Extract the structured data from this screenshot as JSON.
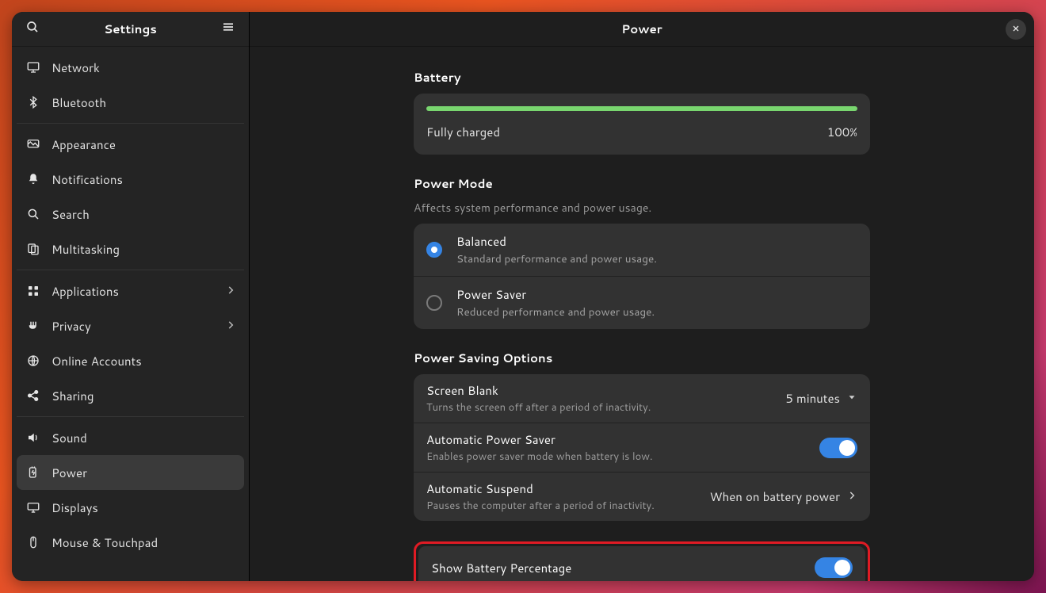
{
  "sidebar": {
    "title": "Settings",
    "items": [
      {
        "label": "Network"
      },
      {
        "label": "Bluetooth"
      },
      {
        "label": "Appearance"
      },
      {
        "label": "Notifications"
      },
      {
        "label": "Search"
      },
      {
        "label": "Multitasking"
      },
      {
        "label": "Applications"
      },
      {
        "label": "Privacy"
      },
      {
        "label": "Online Accounts"
      },
      {
        "label": "Sharing"
      },
      {
        "label": "Sound"
      },
      {
        "label": "Power"
      },
      {
        "label": "Displays"
      },
      {
        "label": "Mouse & Touchpad"
      }
    ]
  },
  "page": {
    "title": "Power",
    "battery": {
      "heading": "Battery",
      "status": "Fully charged",
      "percent": "100%"
    },
    "power_mode": {
      "heading": "Power Mode",
      "subtitle": "Affects system performance and power usage.",
      "options": [
        {
          "title": "Balanced",
          "desc": "Standard performance and power usage."
        },
        {
          "title": "Power Saver",
          "desc": "Reduced performance and power usage."
        }
      ]
    },
    "power_saving": {
      "heading": "Power Saving Options",
      "screen_blank": {
        "title": "Screen Blank",
        "desc": "Turns the screen off after a period of inactivity.",
        "value": "5 minutes"
      },
      "auto_saver": {
        "title": "Automatic Power Saver",
        "desc": "Enables power saver mode when battery is low."
      },
      "auto_suspend": {
        "title": "Automatic Suspend",
        "desc": "Pauses the computer after a period of inactivity.",
        "value": "When on battery power"
      }
    },
    "show_percentage": {
      "title": "Show Battery Percentage"
    }
  }
}
